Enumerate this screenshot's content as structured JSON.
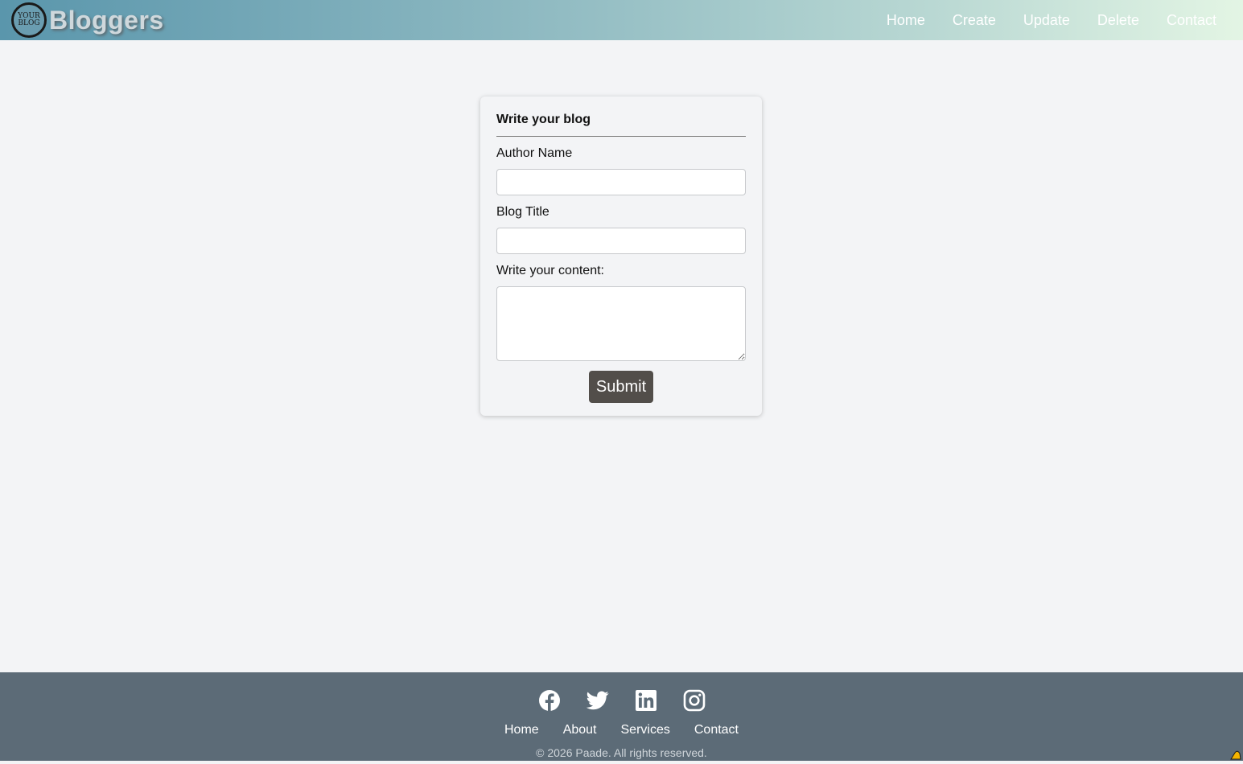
{
  "header": {
    "logo_line1": "YOUR",
    "logo_line2": "BLOG",
    "brand": "Bloggers",
    "nav": [
      "Home",
      "Create",
      "Update",
      "Delete",
      "Contact"
    ]
  },
  "form": {
    "title": "Write your blog",
    "author_label": "Author Name",
    "author_value": "",
    "title_label": "Blog Title",
    "title_value": "",
    "content_label": "Write your content:",
    "content_value": "",
    "submit_label": "Submit"
  },
  "footer": {
    "social_icons": [
      "facebook-icon",
      "twitter-icon",
      "linkedin-icon",
      "instagram-icon"
    ],
    "links": [
      "Home",
      "About",
      "Services",
      "Contact"
    ],
    "copyright": "© 2026 Paade. All rights reserved."
  },
  "colors": {
    "footer_bg": "#5c6b77",
    "button_bg": "#524e4a",
    "page_bg": "#f3f4f6"
  }
}
